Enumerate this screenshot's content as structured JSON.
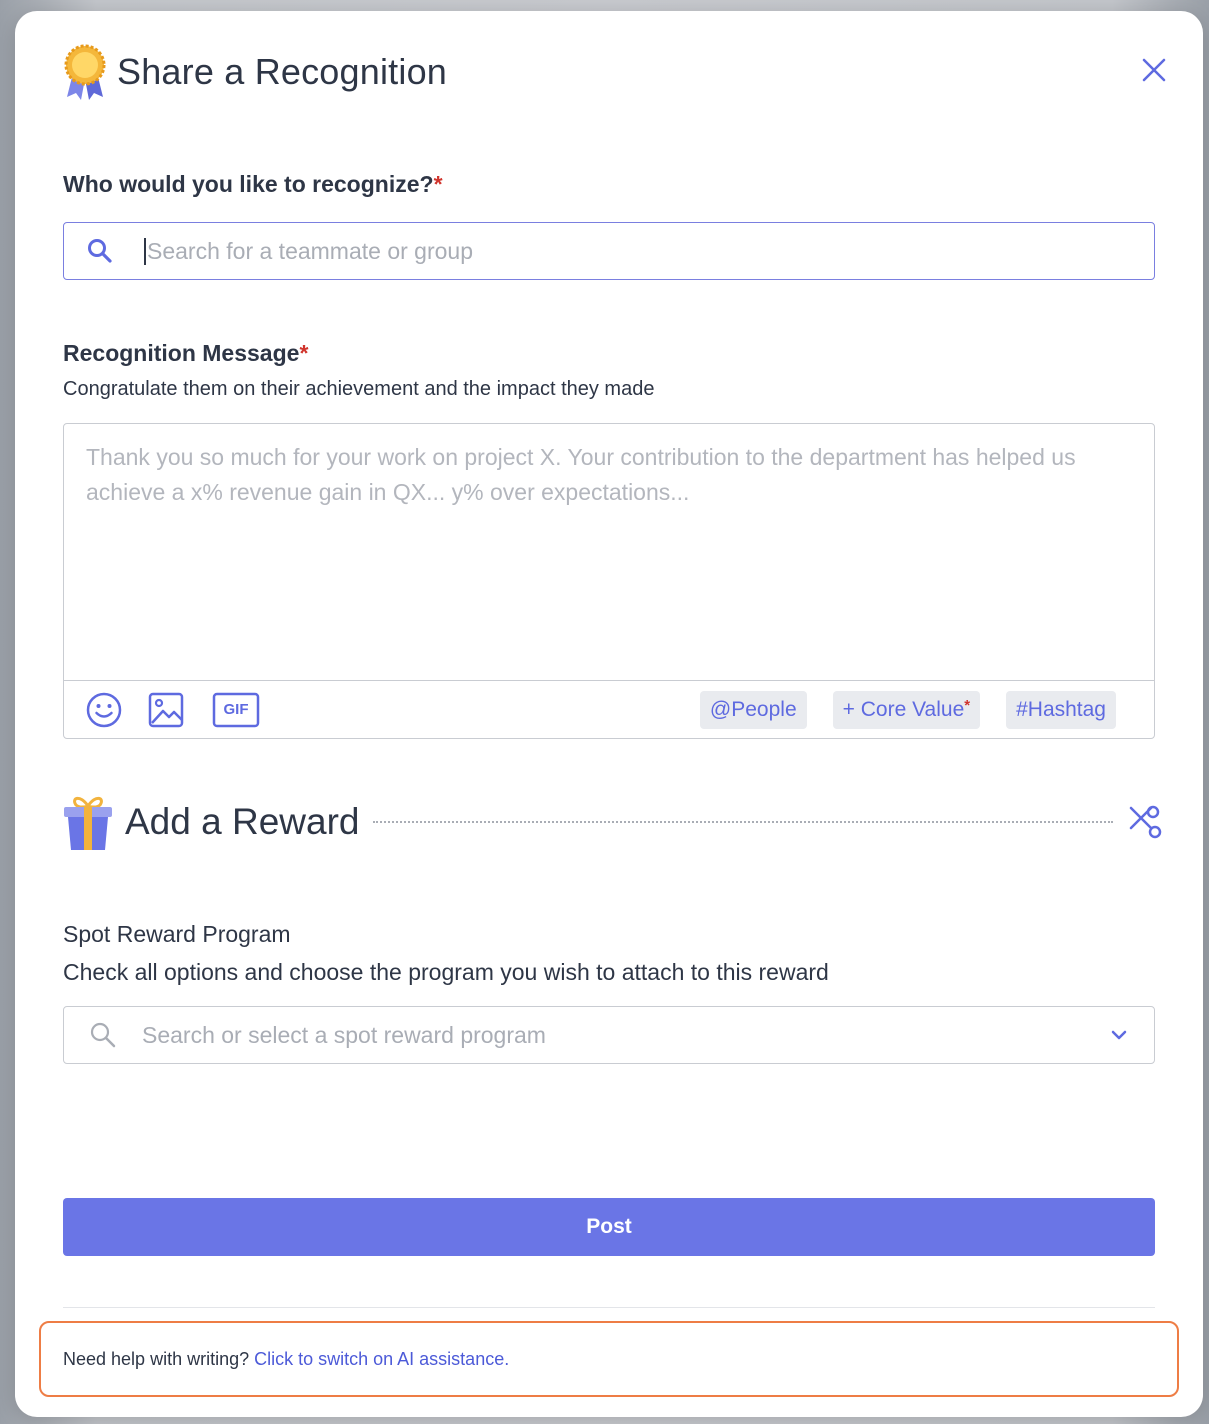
{
  "dialog": {
    "title": "Share a Recognition",
    "medal_icon": "medal-icon",
    "close_icon": "close-icon"
  },
  "recipient": {
    "label": "Who would you like to recognize?",
    "required_mark": "*",
    "search_placeholder": "Search for a teammate or group",
    "search_value": ""
  },
  "message": {
    "label": "Recognition Message",
    "required_mark": "*",
    "helper": "Congratulate them on their achievement and the impact they made",
    "placeholder": "Thank you so much for your work on project X. Your contribution to the department has helped us achieve a x% revenue gain in QX... y% over expectations...",
    "value": "",
    "toolbar": {
      "emoji_icon": "emoji-icon",
      "image_icon": "image-icon",
      "gif_label": "GIF",
      "people_chip": "@People",
      "core_value_chip": "+ Core Value",
      "core_value_required": "*",
      "hashtag_chip": "#Hashtag"
    }
  },
  "reward": {
    "title": "Add a Reward",
    "gift_icon": "gift-icon",
    "remove_icon": "scissors-icon",
    "program_label": "Spot Reward Program",
    "program_helper": "Check all options and choose the program you wish to attach to this reward",
    "select_placeholder": "Search or select a spot reward program"
  },
  "actions": {
    "post_label": "Post"
  },
  "ai_help": {
    "prompt": "Need help with writing?",
    "link": "Click to switch on AI assistance."
  },
  "colors": {
    "accent": "#6a75e6",
    "link": "#4c5ad8",
    "required": "#d0342c",
    "highlight_border": "#ee7d45"
  }
}
